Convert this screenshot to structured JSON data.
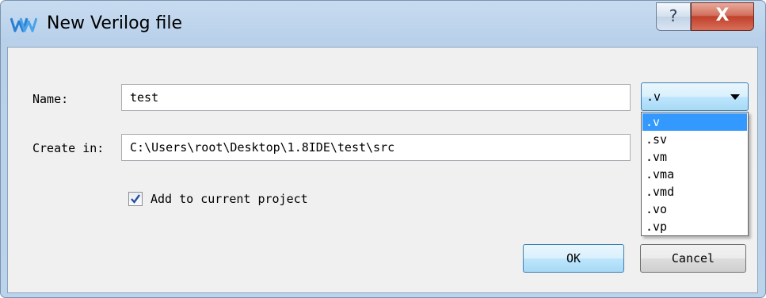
{
  "window": {
    "title": "New Verilog file",
    "help_label": "?",
    "close_label": "X"
  },
  "form": {
    "name_label": "Name:",
    "name_value": "test",
    "create_in_label": "Create in:",
    "create_in_value": "C:\\Users\\root\\Desktop\\1.8IDE\\test\\src",
    "add_to_project_label": "Add to current project",
    "add_to_project_checked": true
  },
  "extension_combo": {
    "selected": ".v",
    "options": [
      ".v",
      ".sv",
      ".vm",
      ".vma",
      ".vmd",
      ".vo",
      ".vp"
    ]
  },
  "buttons": {
    "ok_label": "OK",
    "cancel_label": "Cancel"
  },
  "colors": {
    "selection_highlight": "#3399ff",
    "close_button": "#c0402b",
    "titlebar": "#bcd3ec"
  }
}
